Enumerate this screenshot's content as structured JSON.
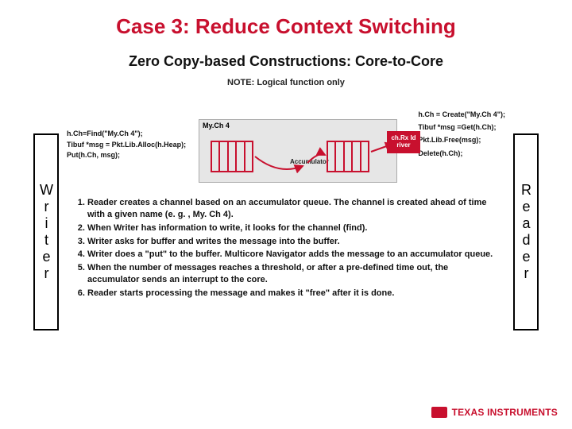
{
  "title": "Case 3: Reduce Context Switching",
  "subtitle": "Zero Copy-based Constructions: Core-to-Core",
  "note": "NOTE: Logical function only",
  "writer_label": "Writer",
  "reader_label": "Reader",
  "mych_label": "My.Ch 4",
  "accumulator_label": "Accumulator",
  "rx_driver": "ch.Rx Id river",
  "code_left": {
    "l1": "h.Ch=Find(\"My.Ch 4\");",
    "l2": "Tibuf *msg = Pkt.Lib.Alloc(h.Heap);",
    "l3": "Put(h.Ch, msg);"
  },
  "code_right": {
    "l1": "h.Ch = Create(\"My.Ch 4\");",
    "l2": "Tibuf *msg =Get(h.Ch);",
    "l3": "Pkt.Lib.Free(msg);",
    "l4": "Delete(h.Ch);"
  },
  "steps": {
    "s1": "Reader creates a channel based on an accumulator queue.  The channel is created ahead of time with a given name (e. g. , My. Ch 4).",
    "s2": "When Writer has information to write, it looks for the channel (find).",
    "s3": "Writer asks for buffer and writes the message into the buffer.",
    "s4": "Writer does a \"put\" to the buffer. Multicore Navigator adds the message to an accumulator queue.",
    "s5": "When the number of messages reaches a threshold, or after a pre-defined time out, the accumulator sends an interrupt to the core.",
    "s6": "Reader starts processing the message and makes it \"free\" after it is done."
  },
  "logo_text": "TEXAS INSTRUMENTS"
}
